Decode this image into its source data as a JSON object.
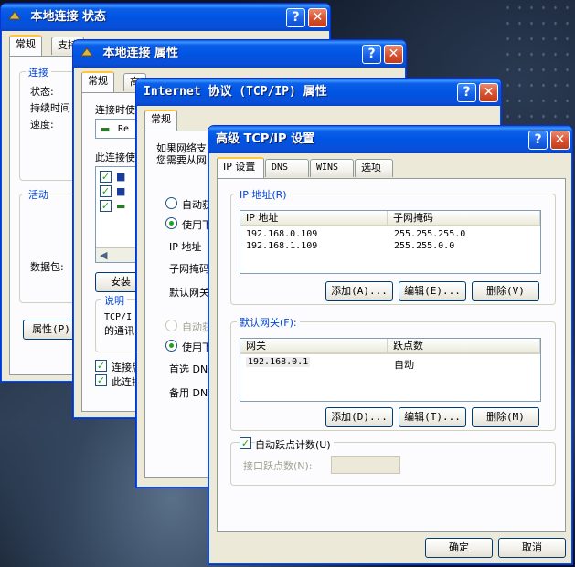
{
  "win1": {
    "title": "本地连接 状态",
    "tabs": [
      "常规",
      "支持"
    ],
    "group_conn": "连接",
    "status": "状态:",
    "duration": "持续时间",
    "speed": "速度:",
    "group_act": "活动",
    "packets": "数据包:",
    "prop_btn": "属性(P)"
  },
  "win2": {
    "title": "本地连接 属性",
    "tabs": [
      "常规",
      "高"
    ],
    "connect_using": "连接时使",
    "adapter": "Re",
    "uses": "此连接使",
    "install_btn": "安装",
    "desc_label": "说明",
    "desc1": "TCP/I",
    "desc2": "的通讯",
    "chk1": "连接后",
    "chk2": "此连接"
  },
  "win3": {
    "title": "Internet 协议 (TCP/IP) 属性",
    "tab": "常规",
    "info1": "如果网络支",
    "info2": "您需要从网",
    "auto_ip": "自动获",
    "use_ip": "使用下",
    "ip": "IP 地址",
    "mask": "子网掩码",
    "gw": "默认网关",
    "auto_dns": "自动获",
    "use_dns": "使用下",
    "dns1": "首选 DN",
    "dns2": "备用 DN"
  },
  "win4": {
    "title": "高级 TCP/IP 设置",
    "tabs": [
      "IP 设置",
      "DNS",
      "WINS",
      "选项"
    ],
    "ip_group": "IP 地址(R)",
    "ip_cols": [
      "IP 地址",
      "子网掩码"
    ],
    "ip_rows": [
      [
        "192.168.0.109",
        "255.255.255.0"
      ],
      [
        "192.168.1.109",
        "255.255.0.0"
      ]
    ],
    "ip_btns": [
      "添加(A)...",
      "编辑(E)...",
      "删除(V)"
    ],
    "gw_group": "默认网关(F):",
    "gw_cols": [
      "网关",
      "跃点数"
    ],
    "gw_rows": [
      [
        "192.168.0.1",
        "自动"
      ]
    ],
    "gw_btns": [
      "添加(D)...",
      "编辑(T)...",
      "删除(M)"
    ],
    "auto_metric": "自动跃点计数(U)",
    "iface_metric": "接口跃点数(N):",
    "ok": "确定",
    "cancel": "取消"
  },
  "title_btns": {
    "help": "?",
    "close": "✕"
  }
}
